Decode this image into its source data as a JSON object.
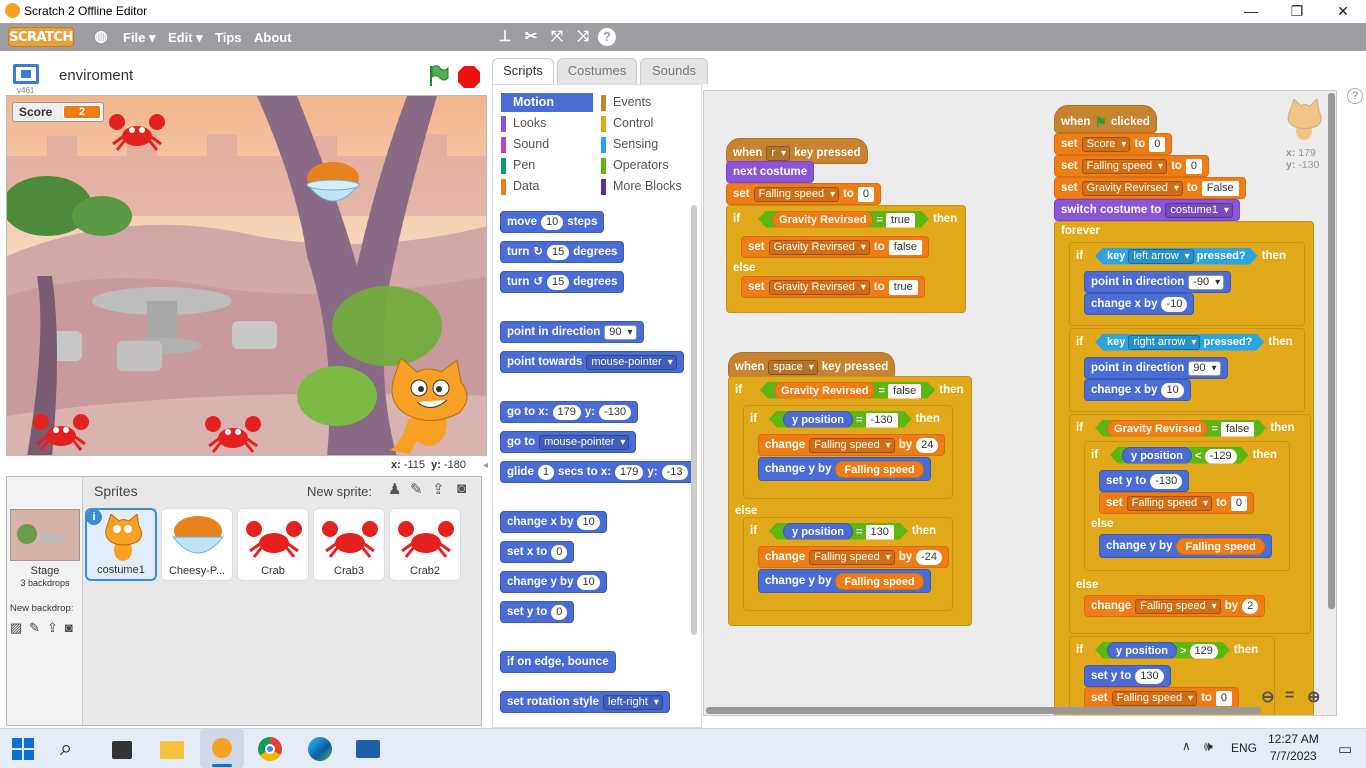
{
  "window": {
    "title": "Scratch 2 Offline Editor",
    "minimize": "—",
    "restore": "❐",
    "close": "✕"
  },
  "menu": {
    "logo": "SCRATCH",
    "file": "File ▾",
    "edit": "Edit ▾",
    "tips": "Tips",
    "about": "About"
  },
  "project": {
    "name": "enviroment",
    "version": "v461"
  },
  "stage": {
    "score_label": "Score",
    "score_value": "2",
    "coords": {
      "x_label": "x:",
      "x": "-115",
      "y_label": "y:",
      "y": "-180"
    }
  },
  "sprites": {
    "header": "Sprites",
    "new_sprite": "New sprite:",
    "stage_label": "Stage",
    "stage_backdrops": "3 backdrops",
    "new_backdrop": "New backdrop:",
    "items": [
      {
        "name": "costume1"
      },
      {
        "name": "Cheesy-P..."
      },
      {
        "name": "Crab"
      },
      {
        "name": "Crab3"
      },
      {
        "name": "Crab2"
      }
    ]
  },
  "tabs": [
    "Scripts",
    "Costumes",
    "Sounds"
  ],
  "categories": [
    {
      "label": "Motion",
      "color": "#4a6cd4"
    },
    {
      "label": "Events",
      "color": "#c88330"
    },
    {
      "label": "Looks",
      "color": "#8a55d7"
    },
    {
      "label": "Control",
      "color": "#e1a91a"
    },
    {
      "label": "Sound",
      "color": "#bb42c3"
    },
    {
      "label": "Sensing",
      "color": "#2ca5e2"
    },
    {
      "label": "Pen",
      "color": "#0e9a6c"
    },
    {
      "label": "Operators",
      "color": "#5cb712"
    },
    {
      "label": "Data",
      "color": "#ee7d16"
    },
    {
      "label": "More Blocks",
      "color": "#632d99"
    }
  ],
  "palette": {
    "move": "move",
    "move_val": "10",
    "steps": "steps",
    "turn": "turn",
    "deg_val": "15",
    "degrees": "degrees",
    "point_dir": "point in direction",
    "dir_val": "90",
    "point_towards": "point towards",
    "mouse": "mouse-pointer",
    "goto_xy": "go to x:",
    "gx": "179",
    "y_lbl": "y:",
    "gy": "-130",
    "goto": "go to",
    "glide": "glide",
    "glide_secs": "1",
    "secs_to_x": "secs to x:",
    "glide_y": "-13",
    "change_x": "change x by",
    "change_val": "10",
    "set_x": "set x to",
    "zero": "0",
    "change_y": "change y by",
    "set_y": "set y to",
    "bounce": "if on edge, bounce",
    "rotation": "set rotation style",
    "rot_val": "left-right"
  },
  "script_words": {
    "when": "when",
    "key_pressed": "key pressed",
    "r": "r",
    "space": "space",
    "next_costume": "next costume",
    "set": "set",
    "to": "to",
    "if": "if",
    "then": "then",
    "else": "else",
    "falling_speed": "Falling speed",
    "gravity": "Gravity Revirsed",
    "score": "Score",
    "true": "true",
    "false": "false",
    "False": "False",
    "zero": "0",
    "y_position": "y position",
    "change": "change",
    "by": "by",
    "change_y_by": "change y by",
    "n130": "-130",
    "p130": "130",
    "p24": "24",
    "n24": "-24",
    "clicked": "clicked",
    "switch_costume": "switch costume to",
    "costume1": "costume1",
    "forever": "forever",
    "key": "key",
    "left_arrow": "left arrow",
    "right_arrow": "right arrow",
    "pressed_q": "pressed?",
    "point_dir": "point in direction",
    "n90": "-90",
    "p90": "90",
    "change_x_by": "change x by",
    "n10": "-10",
    "p10": "10",
    "n129": "-129",
    "p129": "129",
    "set_y_to": "set y to",
    "two": "2",
    "lt": "<",
    "gt": ">",
    "eq": "="
  },
  "sprite_info": {
    "x_label": "x:",
    "x": "179",
    "y_label": "y:",
    "y": "-130"
  },
  "taskbar": {
    "lang": "ENG",
    "time": "12:27 AM",
    "date": "7/7/2023"
  }
}
